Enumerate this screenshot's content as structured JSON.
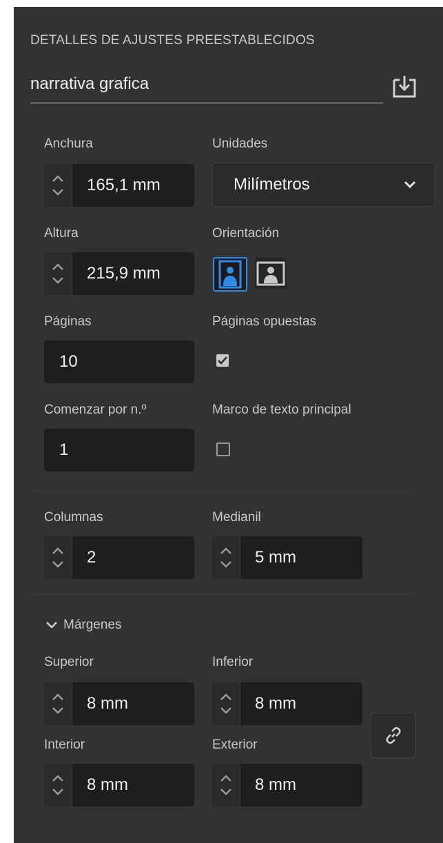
{
  "panel": {
    "section_title": "DETALLES DE AJUSTES PREESTABLECIDOS",
    "preset_name": "narrativa grafica",
    "save_icon": "save-preset-icon"
  },
  "width": {
    "label": "Anchura",
    "value": "165,1 mm"
  },
  "units": {
    "label": "Unidades",
    "value": "Milímetros"
  },
  "height": {
    "label": "Altura",
    "value": "215,9 mm"
  },
  "orientation": {
    "label": "Orientación",
    "selected": "portrait",
    "accent_color": "#2d8ceb"
  },
  "pages": {
    "label": "Páginas",
    "value": "10"
  },
  "facing_pages": {
    "label": "Páginas opuestas",
    "checked": true
  },
  "start_number": {
    "label": "Comenzar por n.º",
    "value": "1"
  },
  "primary_text_frame": {
    "label": "Marco de texto principal",
    "checked": false
  },
  "columns": {
    "label": "Columnas",
    "value": "2"
  },
  "gutter": {
    "label": "Medianil",
    "value": "5 mm"
  },
  "margins": {
    "section_label": "Márgenes",
    "expanded": true,
    "top": {
      "label": "Superior",
      "value": "8 mm"
    },
    "bottom": {
      "label": "Inferior",
      "value": "8 mm"
    },
    "inside": {
      "label": "Interior",
      "value": "8 mm"
    },
    "outside": {
      "label": "Exterior",
      "value": "8 mm"
    },
    "link_icon": "link-icon"
  }
}
